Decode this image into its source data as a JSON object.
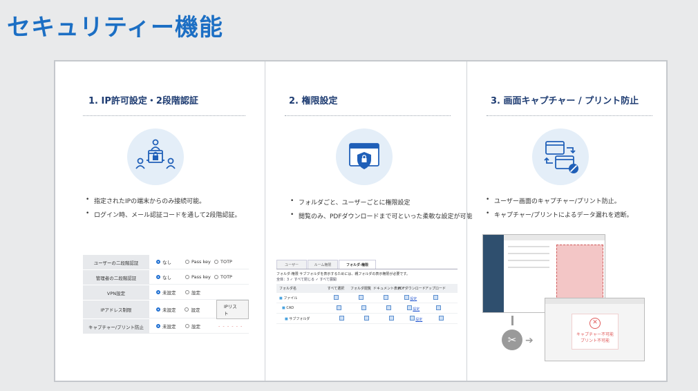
{
  "page_title": "セキュリティー機能",
  "sections": [
    {
      "heading": "1. IP許可設定・2段階認証",
      "icon": "user-lock-icon",
      "bullets": [
        "指定されたIPの端末からのみ接続可能。",
        "ログイン時、メール認証コードを通して2段階認証。"
      ],
      "settings": [
        {
          "label": "ユーザーの二段階認証",
          "options": [
            "なし",
            "Pass key",
            "TOTP"
          ],
          "selected": 0
        },
        {
          "label": "管理者の二段階認証",
          "options": [
            "なし",
            "Pass key",
            "TOTP"
          ],
          "selected": 0
        },
        {
          "label": "VPN設定",
          "options": [
            "未設定",
            "設定"
          ],
          "selected": 0
        },
        {
          "label": "IPアドレス制限",
          "options": [
            "未設定",
            "設定"
          ],
          "selected": 0,
          "button": "IPリスト"
        },
        {
          "label": "キャプチャー/プリント防止",
          "options": [
            "未設定",
            "設定"
          ],
          "selected": 0,
          "note": "- - - - - -"
        }
      ]
    },
    {
      "heading": "2. 権限設定",
      "icon": "shield-lock-icon",
      "bullets": [
        "フォルダごと、ユーザーごとに権限設定",
        "閲覧のみ、PDFダウンロードまで可といった柔軟な設定が可能"
      ],
      "tabs": [
        "ユーザー",
        "ルーム権限",
        "フォルダ-権限"
      ],
      "note": "フォルダ-権限  サブフォルダを表示するためには、親フォルダの表示権限が必要です。",
      "controls": "全体：3   ✓ すべて閉じる  ✓ すべて展開",
      "columns": [
        "フォルダ名",
        "すべて選択",
        "フォルダ閲覧",
        "ドキュメント表示",
        "PDFダウンロード",
        "アップロード"
      ],
      "rows": [
        {
          "name": "ファイル",
          "link": "設定"
        },
        {
          "name": "CAD",
          "link": "設定"
        },
        {
          "name": "サブフォルダ",
          "link": "設定"
        }
      ]
    },
    {
      "heading": "3. 画面キャプチャー / プリント防止",
      "icon": "screen-block-icon",
      "bullets": [
        "ユーザー画面のキャプチャー/プリント防止。",
        "キャプチャー/プリントによるデータ漏れを遮断。"
      ],
      "warning": [
        "キャプチャー不可能",
        "プリント不可能"
      ]
    }
  ],
  "colors": {
    "title": "#1c6fc4",
    "heading": "#1e3c72",
    "accent": "#1f6fd1",
    "warn": "#e05a5a"
  }
}
